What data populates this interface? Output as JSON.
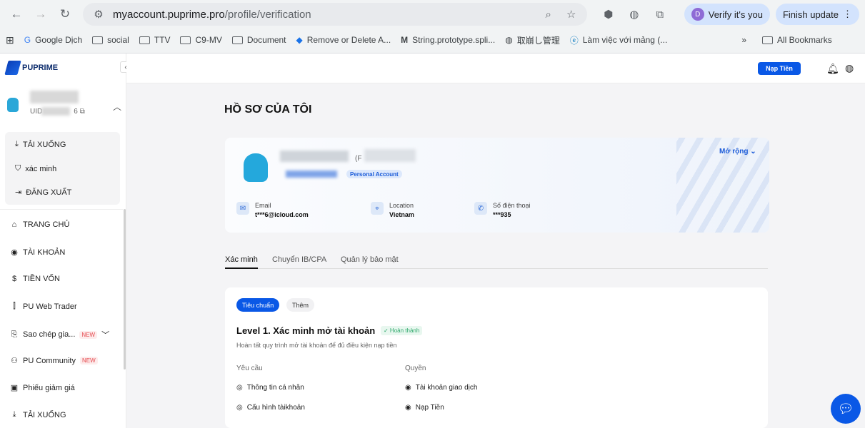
{
  "browser": {
    "url_domain": "myaccount.puprime.pro",
    "url_path": "/profile/verification",
    "verify_label": "Verify it's you",
    "verify_avatar": "D",
    "finish_label": "Finish update",
    "bookmarks": [
      "Google Dịch",
      "social",
      "TTV",
      "C9-MV",
      "Document",
      "Remove or Delete A...",
      "String.prototype.spli...",
      "取崩し管理",
      "Làm việc với mảng (..."
    ],
    "all_bookmarks": "All Bookmarks"
  },
  "sidebar": {
    "brand": "PUPRIME",
    "uid_prefix": "UID",
    "uid_suffix": "6",
    "submenu": [
      "TẢI XUỐNG",
      "xác minh",
      "ĐĂNG XUẤT"
    ],
    "nav": [
      "TRANG CHỦ",
      "TÀI KHOẢN",
      "TIỀN VỐN",
      "PU Web Trader",
      "Sao chép giа...",
      "PU Community",
      "Phiếu giảm giá",
      "TẢI XUỐNG"
    ],
    "new_badge": "NEW"
  },
  "topbar": {
    "deposit_label": "Nạp Tiền"
  },
  "main": {
    "title": "HỒ SƠ CỦA TÔI",
    "profile": {
      "name_suffix": "(F",
      "account_type": "Personal Account",
      "expand_label": "Mở rộng",
      "email_label": "Email",
      "email_value": "t***6@icloud.com",
      "location_label": "Location",
      "location_value": "Vietnam",
      "phone_label": "Số điện thoại",
      "phone_value": "***935"
    },
    "tabs": [
      "Xác minh",
      "Chuyển IB/CPA",
      "Quản lý bảo mật"
    ],
    "card": {
      "segments": [
        "Tiêu chuẩn",
        "Thêm"
      ],
      "level_title": "Level 1. Xác minh mở tài khoản",
      "status": "✓ Hoàn thành",
      "description": "Hoàn tất quy trình mở tài khoản để đủ điều kiện nạp tiền",
      "col_requirements": "Yêu cầu",
      "col_rights": "Quyền",
      "requirements": [
        "Thông tin cá nhân",
        "Cấu hình tàikhoản"
      ],
      "rights": [
        "Tài khoản giao dịch",
        "Nạp Tiền"
      ]
    }
  },
  "colors": {
    "accent": "#0a58e6",
    "brand": "#0a2a6b",
    "success": "#2ea86b",
    "new": "#e5484d"
  }
}
